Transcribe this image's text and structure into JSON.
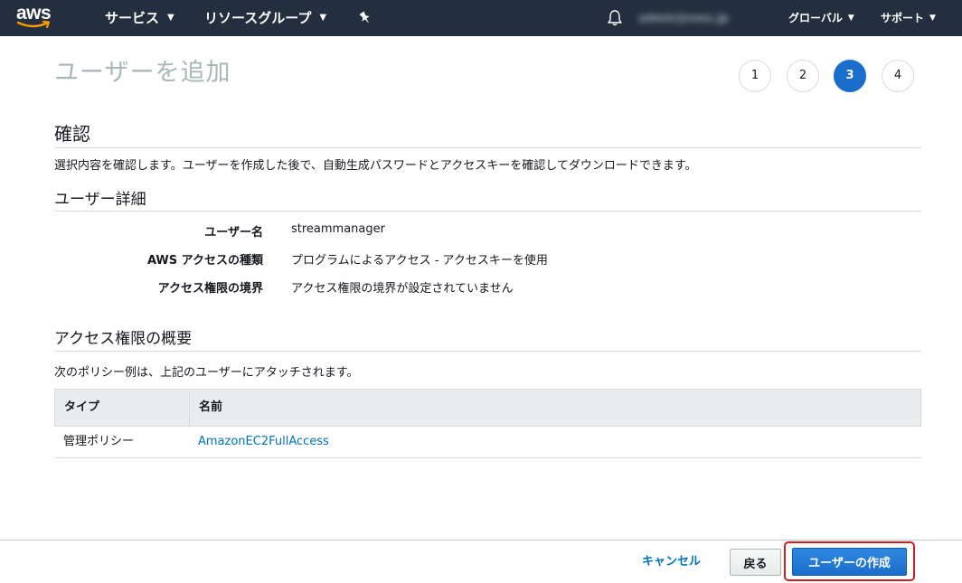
{
  "nav": {
    "logo_text": "aws",
    "services_label": "サービス",
    "resource_groups_label": "リソースグループ",
    "pin_icon": "pin-icon",
    "bell_icon": "bell-icon",
    "account_label": "admin@nmx.jp",
    "region_label": "グローバル",
    "support_label": "サポート",
    "chevron_icon": "chevron-down-icon",
    "bg_color": "#232f3e",
    "logo_accent_color": "#ff9900"
  },
  "page": {
    "title": "ユーザーを追加"
  },
  "steps": [
    {
      "label": "1",
      "active": false
    },
    {
      "label": "2",
      "active": false
    },
    {
      "label": "3",
      "active": true
    },
    {
      "label": "4",
      "active": false
    }
  ],
  "review": {
    "heading": "確認",
    "description": "選択内容を確認します。ユーザーを作成した後で、自動生成パスワードとアクセスキーを確認してダウンロードできます。"
  },
  "user_details": {
    "heading": "ユーザー詳細",
    "rows": [
      {
        "label": "ユーザー名",
        "value": "streammanager"
      },
      {
        "label": "AWS アクセスの種類",
        "value": "プログラムによるアクセス - アクセスキーを使用"
      },
      {
        "label": "アクセス権限の境界",
        "value": "アクセス権限の境界が設定されていません"
      }
    ]
  },
  "permissions": {
    "heading": "アクセス権限の概要",
    "description": "次のポリシー例は、上記のユーザーにアタッチされます。",
    "columns": [
      "タイプ",
      "名前"
    ],
    "rows": [
      {
        "type": "管理ポリシー",
        "name": "AmazonEC2FullAccess"
      }
    ]
  },
  "footer": {
    "cancel_label": "キャンセル",
    "back_label": "戻る",
    "create_label": "ユーザーの作成",
    "primary_color": "#1a6dcb",
    "highlight_color": "#cc1f1f"
  }
}
